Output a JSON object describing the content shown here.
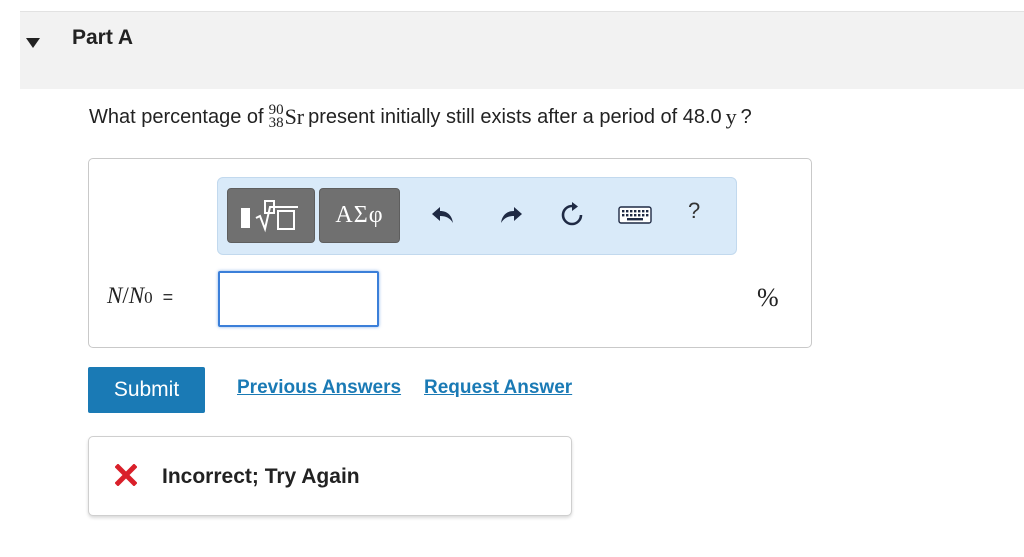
{
  "part": {
    "title": "Part A",
    "toggle_icon": "caret-down-icon"
  },
  "question": {
    "prefix": "What percentage of",
    "nuclide_mass": "90",
    "nuclide_atomic": "38",
    "nuclide_symbol": "Sr",
    "middle": "present initially still exists after a period of 48.0",
    "unit_var": "y",
    "suffix": "?"
  },
  "toolbar": {
    "templates_icon": "templates-radical-icon",
    "greek_label": "ΑΣφ",
    "undo_icon": "undo-arrow-icon",
    "redo_icon": "redo-arrow-icon",
    "reset_icon": "reset-icon",
    "keyboard_icon": "keyboard-icon",
    "help_label": "?"
  },
  "answer": {
    "var_N": "N",
    "slash": "/",
    "var_N0": "N",
    "sub_0": "0",
    "equals": "=",
    "input_value": "",
    "unit": "%"
  },
  "actions": {
    "submit_label": "Submit",
    "previous_answers_label": "Previous Answers",
    "request_answer_label": "Request Answer"
  },
  "feedback": {
    "icon": "x-mark-icon",
    "text": "Incorrect; Try Again",
    "icon_color": "#d9202a"
  },
  "colors": {
    "accent": "#1a7ab5",
    "toolbar_bg": "#d9eaf9",
    "input_border": "#3b7fd9"
  }
}
